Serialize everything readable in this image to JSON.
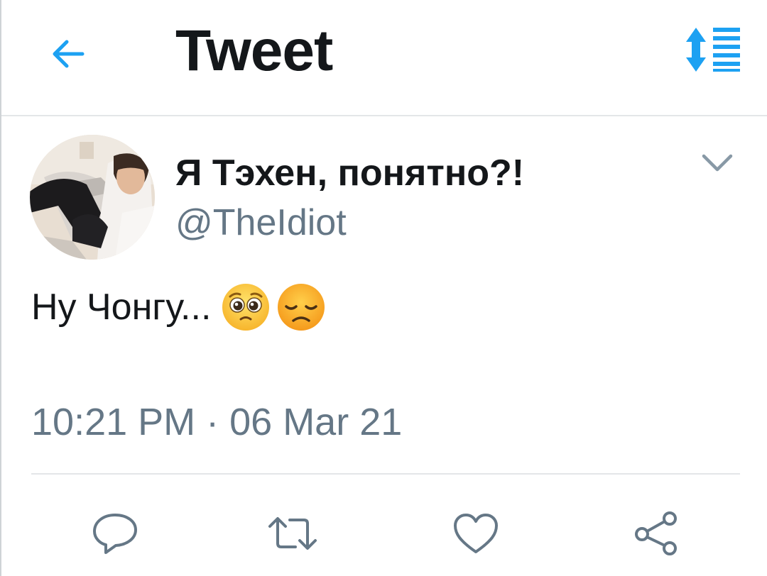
{
  "header": {
    "title": "Tweet",
    "back_icon": "back-arrow-icon",
    "sort_icon": "sort-list-icon"
  },
  "tweet": {
    "display_name": "Я Тэхен, понятно?!",
    "handle": "@TheIdiot",
    "text": "Ну Чонгу...",
    "emojis": [
      "pleading-face-emoji",
      "disappointed-face-emoji"
    ],
    "timestamp": "10:21 PM · 06 Mar 21",
    "menu_icon": "chevron-down-icon"
  },
  "actions": [
    "reply-icon",
    "retweet-icon",
    "like-icon",
    "share-icon"
  ],
  "colors": {
    "accent": "#1da1f2",
    "text": "#14171a",
    "secondary": "#657786",
    "divider": "#e3e6e8",
    "action_icon": "#657786"
  }
}
